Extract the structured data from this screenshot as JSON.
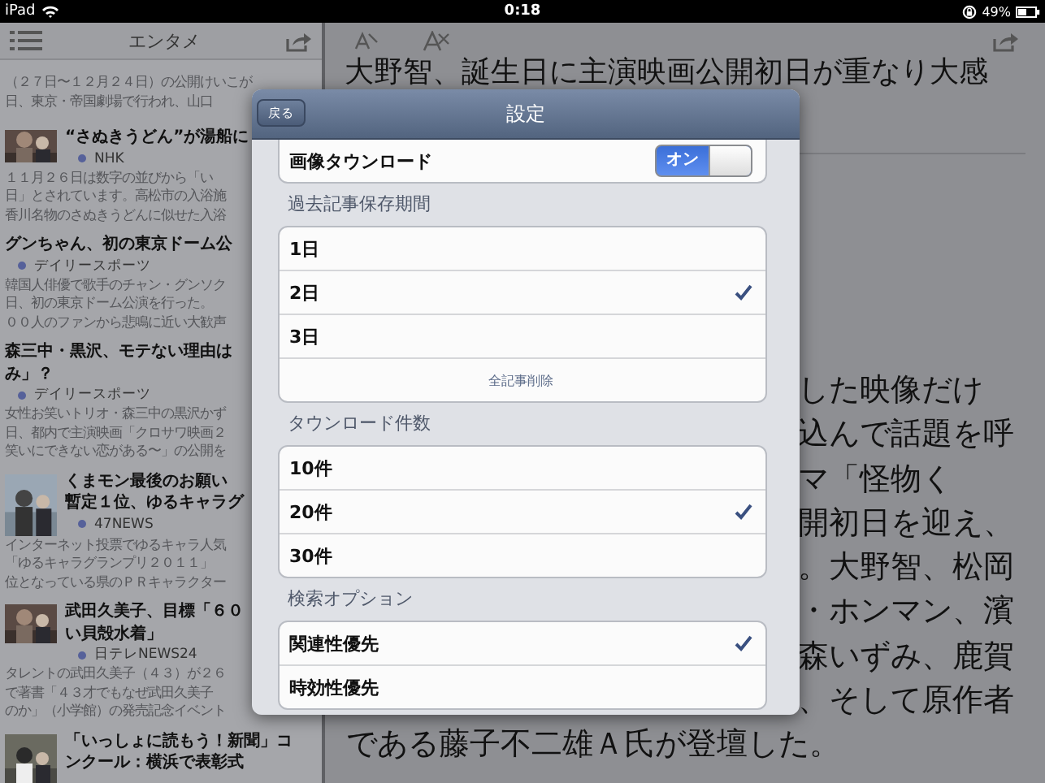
{
  "status_bar": {
    "device": "iPad",
    "time": "0:18",
    "battery": "49%"
  },
  "news_list": {
    "title": "エンタメ",
    "lead_lines": [
      "（２７日〜１２月２４日）の公開けいこが",
      "日、東京・帝国劇場で行われ、山口"
    ],
    "items": [
      {
        "title_lines": [
          "“さぬきうどん”が湯船に"
        ],
        "source": "NHK",
        "snippet_lines": [
          "１１月２６日は数字の並びから「い",
          "日」とされています。高松市の入浴施",
          "香川名物のさぬきうどんに似せた入浴"
        ]
      },
      {
        "kind": "text",
        "title_lines": [
          "グンちゃん、初の東京ドーム公"
        ],
        "source": "デイリースポーツ",
        "snippet_lines": [
          "韓国人俳優で歌手のチャン・グンソク",
          "日、初の東京ドーム公演を行った。",
          "００人のファンから悲鳴に近い大歓声"
        ]
      },
      {
        "kind": "text",
        "title_lines": [
          "森三中・黒沢、モテない理由は",
          "み」？"
        ],
        "source": "デイリースポーツ",
        "snippet_lines": [
          "女性お笑いトリオ・森三中の黒沢かず",
          "日、都内で主演映画「クロサワ映画２",
          "笑いにできない恋がある〜」の公開を"
        ]
      },
      {
        "title_lines": [
          "くまモン最後のお願い",
          "暫定１位、ゆるキャラグ"
        ],
        "source": "47NEWS",
        "snippet_lines": [
          "インターネット投票でゆるキャラ人気",
          "「ゆるキャラグランプリ２０１１」",
          "位となっている県のＰＲキャラクター"
        ]
      },
      {
        "title_lines": [
          "武田久美子、目標「６０",
          "い貝殻水着」"
        ],
        "source": "日テレNEWS24",
        "snippet_lines": [
          "タレントの武田久美子（４３）が２６",
          "で著書「４３才でもなぜ武田久美子",
          "のか」（小学館）の発売記念イベント"
        ]
      },
      {
        "title_lines": [
          "「いっしょに読もう！新聞」コ",
          "ンクール：横浜で表彰式"
        ]
      }
    ]
  },
  "article": {
    "title": "大野智、誕生日に主演映画公開初日が重なり大感",
    "body_lines": [
      "した映像だけ",
      "込んで話題を呼",
      "マ「怪物く",
      "開初日を迎え、",
      "。大野智、松岡",
      "・ホンマン、濱",
      "森いずみ、鹿賀",
      "、そして原作者"
    ],
    "last_line": "である藤子不二雄Ａ氏が登壇した。"
  },
  "settings": {
    "title": "設定",
    "back": "戻る",
    "image_download": {
      "label": "画像タウンロード",
      "on": true,
      "on_label": "オン"
    },
    "sections": [
      {
        "header": "過去記事保存期間",
        "options": [
          {
            "label": "1日",
            "selected": false
          },
          {
            "label": "2日",
            "selected": true
          },
          {
            "label": "3日",
            "selected": false
          }
        ],
        "action": "全記事削除"
      },
      {
        "header": "タウンロード件数",
        "options": [
          {
            "label": "10件",
            "selected": false
          },
          {
            "label": "20件",
            "selected": true
          },
          {
            "label": "30件",
            "selected": false
          }
        ]
      },
      {
        "header": "検索オプション",
        "options": [
          {
            "label": "関連性優先",
            "selected": true
          },
          {
            "label": "時効性優先",
            "selected": false
          }
        ]
      }
    ]
  }
}
